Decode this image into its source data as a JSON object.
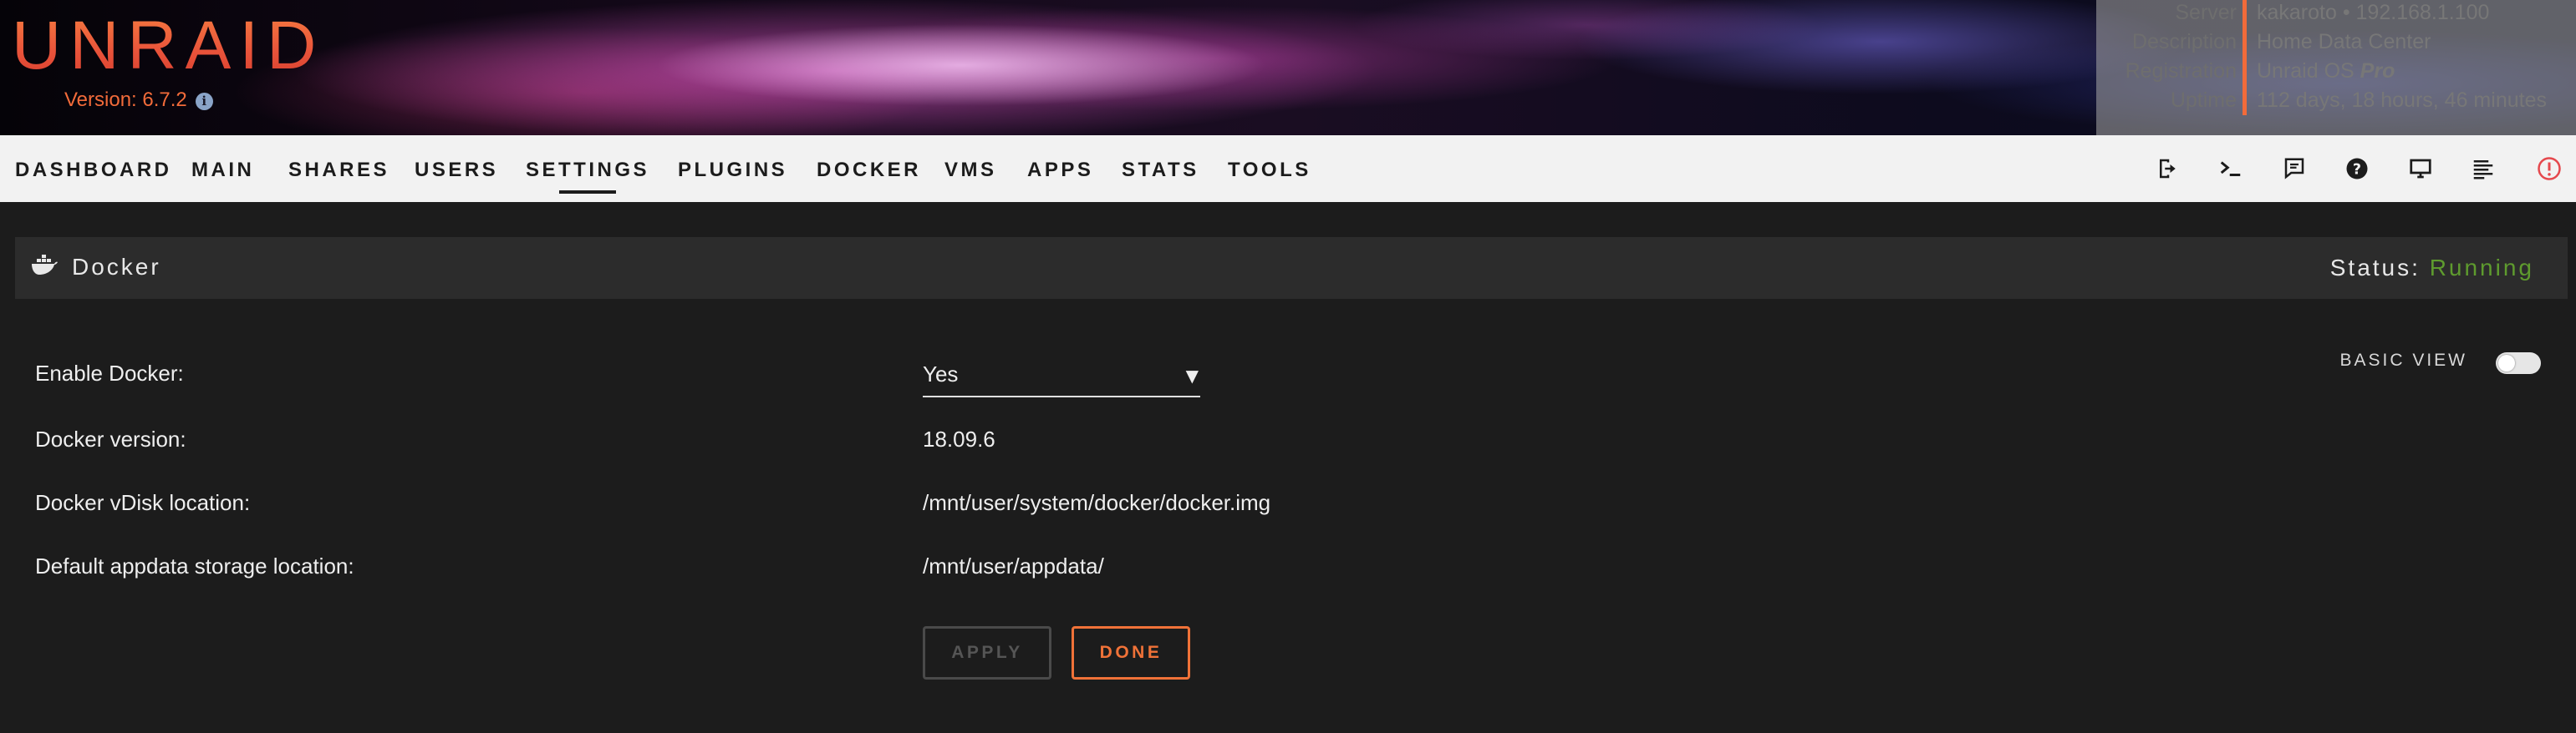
{
  "header": {
    "logo_text": "UNRAID",
    "version_label": "Version: 6.7.2",
    "info_icon": "info-circle-icon",
    "server_info": [
      {
        "key": "Server",
        "value": "kakaroto • 192.168.1.100"
      },
      {
        "key": "Description",
        "value": "Home Data Center"
      },
      {
        "key": "Registration",
        "value": "Unraid OS",
        "value_emphasis": "Pro"
      },
      {
        "key": "Uptime",
        "value": "112 days, 18 hours, 46 minutes"
      }
    ]
  },
  "nav": {
    "items": [
      {
        "label": "DASHBOARD"
      },
      {
        "label": "MAIN"
      },
      {
        "label": "SHARES"
      },
      {
        "label": "USERS"
      },
      {
        "label": "SETTINGS",
        "active": true
      },
      {
        "label": "PLUGINS"
      },
      {
        "label": "DOCKER"
      },
      {
        "label": "VMS"
      },
      {
        "label": "APPS"
      },
      {
        "label": "STATS"
      },
      {
        "label": "TOOLS"
      }
    ],
    "icons": [
      "logout-icon",
      "terminal-icon",
      "feedback-icon",
      "help-icon",
      "desktop-icon",
      "log-icon",
      "alert-icon"
    ]
  },
  "section": {
    "icon": "docker-whale-icon",
    "title": "Docker",
    "status_label": "Status:",
    "status_value": "Running",
    "status_color": "#5e9b2e"
  },
  "basic_view": {
    "label": "BASIC VIEW",
    "enabled": false
  },
  "form": {
    "enable_docker": {
      "label": "Enable Docker:",
      "value": "Yes",
      "chevron": "▼"
    },
    "docker_version": {
      "label": "Docker version:",
      "value": "18.09.6"
    },
    "vdisk_location": {
      "label": "Docker vDisk location:",
      "value": "/mnt/user/system/docker/docker.img"
    },
    "appdata_location": {
      "label": "Default appdata storage location:",
      "value": "/mnt/user/appdata/"
    }
  },
  "buttons": {
    "apply": "APPLY",
    "done": "DONE"
  },
  "colors": {
    "accent": "#f07238",
    "background": "#1c1c1c",
    "navbar": "#f2f2f2"
  }
}
